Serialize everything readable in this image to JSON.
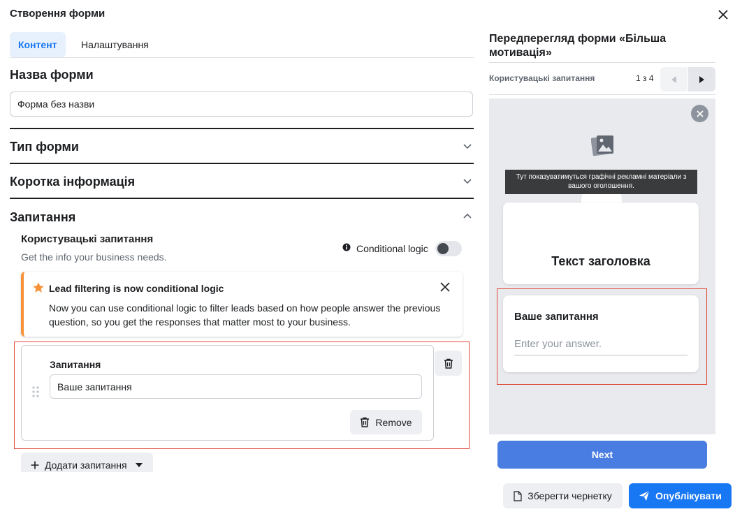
{
  "modal": {
    "title": "Створення форми"
  },
  "tabs": [
    {
      "label": "Контент",
      "active": true
    },
    {
      "label": "Налаштування",
      "active": false
    }
  ],
  "form_name": {
    "heading": "Назва форми",
    "value": "Форма без назви"
  },
  "sections": {
    "form_type": "Тип форми",
    "intro": "Коротка інформація",
    "questions": "Запитання"
  },
  "custom_questions": {
    "title": "Користувацькі запитання",
    "description": "Get the info your business needs.",
    "conditional_label": "Conditional logic",
    "conditional_enabled": false
  },
  "notice": {
    "title": "Lead filtering is now conditional logic",
    "body": "Now you can use conditional logic to filter leads based on how people answer the previous question, so you get the responses that matter most to your business.",
    "accent": "#f7923b"
  },
  "question_card": {
    "label": "Запитання",
    "value": "Ваше запитання",
    "remove_label": "Remove"
  },
  "add_question_label": "Додати запитання",
  "preview": {
    "title": "Передперегляд форми «Більша мотивація»",
    "section_label": "Користувацькі запитання",
    "page_counter": "1 з 4",
    "tooltip": "Тут показуватимуться графічні рекламні матеріали з вашого оголошення.",
    "headline": "Текст заголовка",
    "question": "Ваше запитання",
    "answer_placeholder": "Enter your answer.",
    "next_label": "Next"
  },
  "footer": {
    "save_draft_label": "Зберегти чернетку",
    "publish_label": "Опублікувати"
  },
  "colors": {
    "primary": "#1877f2",
    "next_button": "#4a7de2",
    "highlight_border": "#e04a3a"
  }
}
